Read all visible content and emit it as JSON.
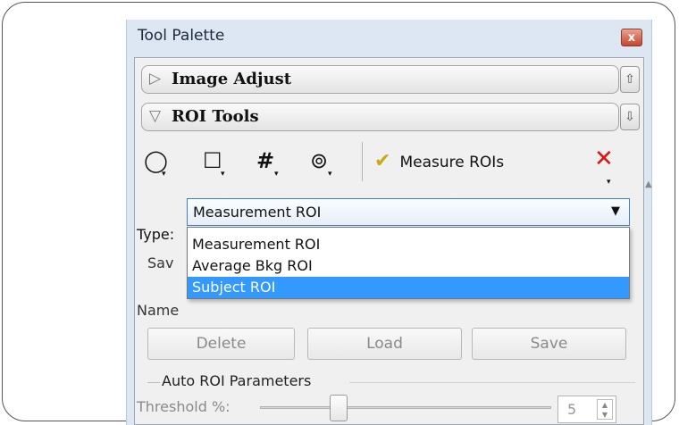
{
  "window": {
    "title": "Tool Palette",
    "close_glyph": "x"
  },
  "sections": {
    "image_adjust": {
      "arrow": "▷",
      "label": "Image Adjust",
      "side_icon": "up-arrow-icon",
      "side_glyph": "⇧"
    },
    "roi_tools": {
      "arrow": "▽",
      "label": "ROI Tools",
      "side_icon": "down-arrow-icon",
      "side_glyph": "⇩"
    }
  },
  "toolbar": {
    "tools": [
      {
        "icon": "ellipse-roi-icon",
        "glyph": "◯",
        "dropdown": "▾"
      },
      {
        "icon": "rectangle-roi-icon",
        "glyph": "☐",
        "dropdown": "▾"
      },
      {
        "icon": "grid-roi-icon",
        "glyph": "#",
        "dropdown": "▾"
      },
      {
        "icon": "auto-roi-icon",
        "glyph": "⊚",
        "dropdown": "▾"
      }
    ],
    "measure_label": "Measure ROIs",
    "delete_glyph": "✕",
    "delete_dropdown": "▾"
  },
  "type_field": {
    "label": "Type:",
    "selected": "Measurement ROI",
    "caret": "▼",
    "options": [
      "Measurement ROI",
      "Average Bkg ROI",
      "Subject ROI"
    ],
    "highlighted_index": 2
  },
  "hidden_fragments": {
    "save_group": "Sav",
    "name_label": "Name"
  },
  "buttons": {
    "delete": "Delete",
    "load": "Load",
    "save": "Save"
  },
  "auto_roi": {
    "group_title": "Auto ROI Parameters",
    "threshold_label": "Threshold %:",
    "threshold_value": "5"
  },
  "colors": {
    "highlight": "#3399ff",
    "delete_red": "#e01212",
    "window_bg": "#dde7f3"
  }
}
